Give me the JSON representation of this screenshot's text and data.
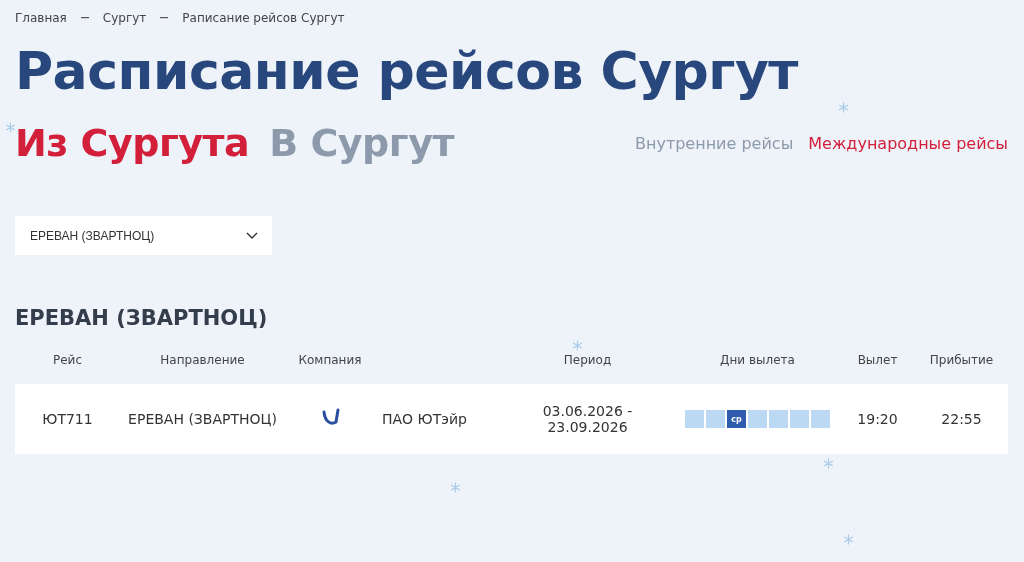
{
  "breadcrumbs": [
    {
      "label": "Главная"
    },
    {
      "label": "Сургут"
    },
    {
      "label": "Раписание рейсов Сургут"
    }
  ],
  "title": "Расписание рейсов Сургут",
  "direction_tabs": [
    {
      "label": "Из Сургута",
      "selected": true
    },
    {
      "label": "В Сургут",
      "selected": false
    }
  ],
  "flight_type_tabs": [
    {
      "label": "Внутренние рейсы",
      "selected": false
    },
    {
      "label": "Международные рейсы",
      "selected": true
    }
  ],
  "destination_select": {
    "value": "ЕРЕВАН (ЗВАРТНОЦ)"
  },
  "section_title": "ЕРЕВАН (ЗВАРТНОЦ)",
  "table": {
    "columns": [
      "Рейс",
      "Направление",
      "Компания",
      "Период",
      "Дни вылета",
      "Вылет",
      "Прибытие"
    ],
    "rows": [
      {
        "flight": "ЮТ711",
        "destination": "ЕРЕВАН (ЗВАРТНОЦ)",
        "company": "ПАО ЮТэйр",
        "period": "03.06.2026 - 23.09.2026",
        "days": [
          {
            "selected": false
          },
          {
            "selected": false
          },
          {
            "label": "ср",
            "selected": true
          },
          {
            "selected": false
          },
          {
            "selected": false
          },
          {
            "selected": false
          },
          {
            "selected": false
          }
        ],
        "departure": "19:20",
        "arrival": "22:55"
      }
    ]
  }
}
